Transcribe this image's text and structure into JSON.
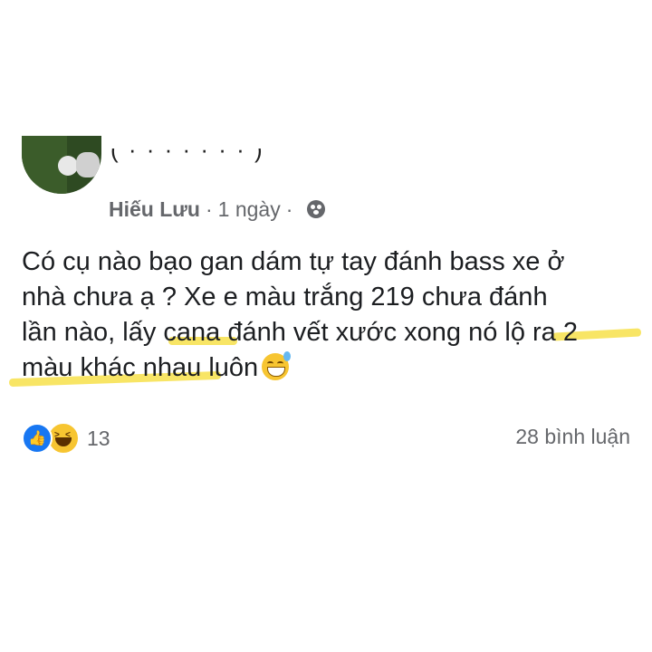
{
  "post": {
    "author": "Hiếu Lưu",
    "separator": "·",
    "time": "1 ngày",
    "privacy_icon": "friends-icon",
    "text_lines": [
      "Có cụ nào bạo gan dám tự tay đánh bass xe ở",
      "nhà chưa ạ ? Xe e màu trắng 219 chưa đánh",
      "lần nào, lấy cana đánh vết xước xong nó lộ ra 2",
      "màu khác nhau luôn"
    ],
    "emoji": "grinning-sweat-emoji",
    "highlight_color": "#f7e04a"
  },
  "footer": {
    "reaction_icons": [
      "like-icon",
      "haha-icon"
    ],
    "reaction_count": "13",
    "comments": "28 bình luận"
  },
  "colors": {
    "meta_text": "#65676b",
    "body_text": "#1c1e21",
    "like_blue": "#1877f2"
  }
}
